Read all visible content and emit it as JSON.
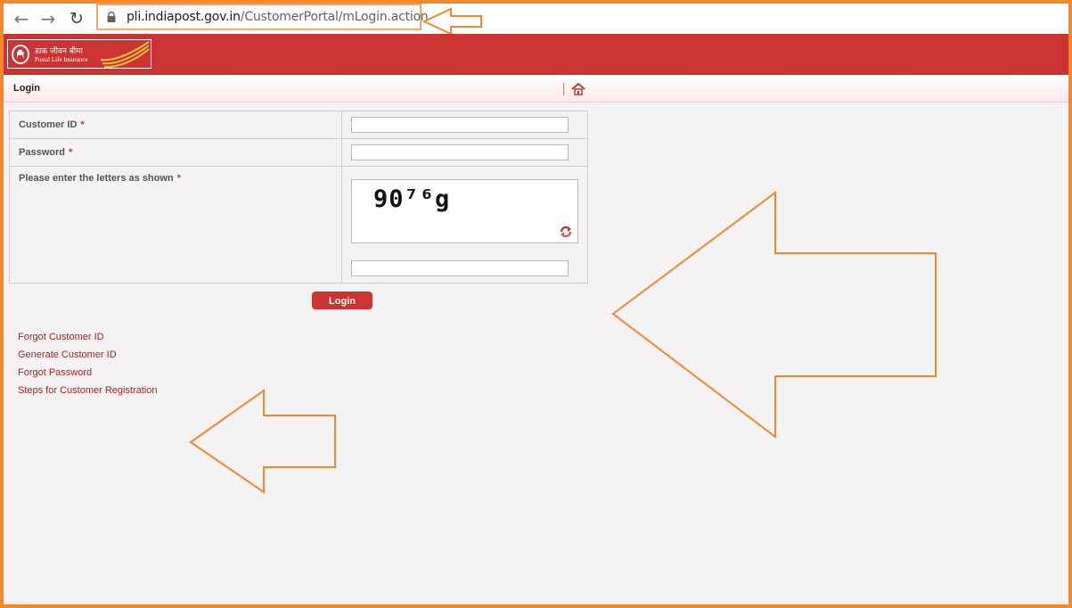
{
  "browser": {
    "url_host": "pli.indiapost.gov.in",
    "url_path": "/CustomerPortal/mLogin.action"
  },
  "header": {
    "logo_hindi": "डाक जीवन बीमा",
    "logo_english": "Postal Life Insurance"
  },
  "breadcrumb": {
    "title": "Login"
  },
  "form": {
    "customer_id_label": "Customer ID",
    "password_label": "Password",
    "captcha_label": "Please enter the letters as shown",
    "required_mark": "*",
    "captcha_text": "90⁷⁶g",
    "login_label": "Login"
  },
  "links": [
    {
      "label": "Forgot Customer ID"
    },
    {
      "label": "Generate Customer ID"
    },
    {
      "label": "Forgot Password"
    },
    {
      "label": "Steps for Customer Registration"
    }
  ],
  "colors": {
    "brand_red": "#cc3333",
    "annotation_orange": "#f5872d"
  }
}
